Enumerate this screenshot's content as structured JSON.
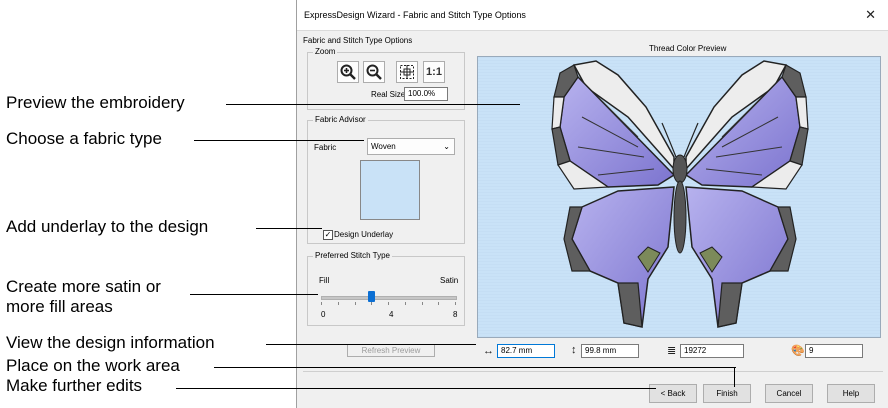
{
  "callouts": [
    "Preview the embroidery",
    "Choose a fabric type",
    "Add underlay to the design",
    "Create more satin or\nmore fill areas",
    "View the design information",
    "Place on the work area",
    "Make further edits"
  ],
  "dialog": {
    "title": "ExpressDesign Wizard - Fabric and Stitch Type Options",
    "section_title": "Fabric and Stitch Type Options",
    "zoom": {
      "label": "Zoom",
      "real_size_label": "Real Size",
      "real_size_value": "100.0%",
      "one_to_one": "1:1"
    },
    "fabric_advisor": {
      "label": "Fabric Advisor",
      "fabric_label": "Fabric",
      "fabric_value": "Woven",
      "underlay_label": "Design Underlay",
      "underlay_checked": true
    },
    "stitch_type": {
      "label": "Preferred Stitch Type",
      "left_label": "Fill",
      "right_label": "Satin",
      "min": "0",
      "mid": "4",
      "max": "8",
      "value": 3
    },
    "preview_label": "Thread Color Preview",
    "refresh_label": "Refresh Preview",
    "width_value": "82.7 mm",
    "height_value": "99.8 mm",
    "stitches_value": "19272",
    "colors_value": "9",
    "buttons": {
      "back": "< Back",
      "finish": "Finish",
      "cancel": "Cancel",
      "help": "Help"
    }
  },
  "colors": {
    "preview_bg": "#c9e2f7",
    "wing_purple": "#8b86d8",
    "wing_dark": "#5e5e5e",
    "body": "#555555"
  }
}
